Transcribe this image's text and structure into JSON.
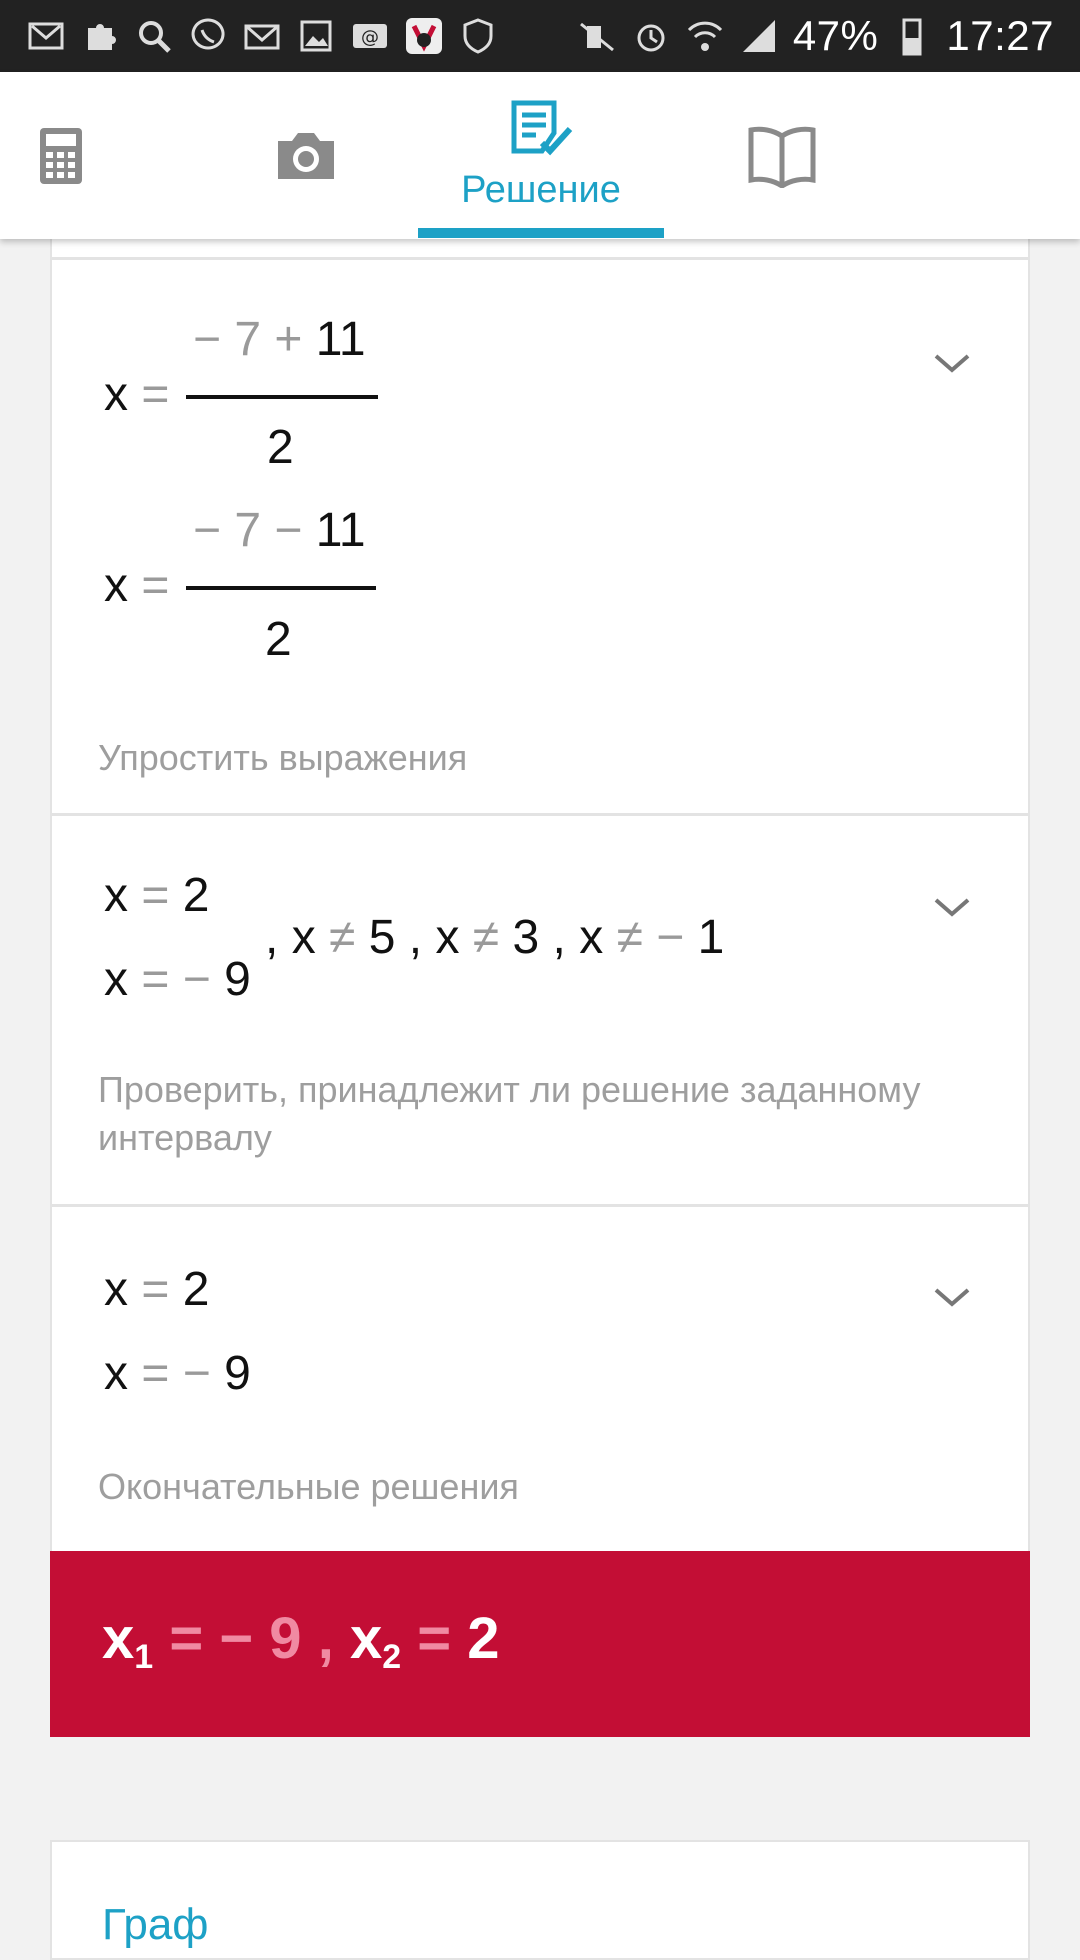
{
  "status_bar": {
    "battery": "47%",
    "time": "17:27",
    "left_icons": [
      "gmail-icon",
      "puzzle-icon",
      "search-icon",
      "viber-icon",
      "mail-icon",
      "gallery-icon",
      "email-at-icon",
      "game-icon",
      "shield-icon"
    ],
    "right_icons": [
      "mute-icon",
      "alarm-icon",
      "wifi-icon",
      "signal-icon",
      "battery-icon"
    ]
  },
  "tabs": [
    {
      "name": "calculator",
      "icon": "calculator-icon",
      "label": ""
    },
    {
      "name": "camera",
      "icon": "camera-icon",
      "label": ""
    },
    {
      "name": "solution",
      "icon": "solution-icon",
      "label": "Решение",
      "active": true
    },
    {
      "name": "book",
      "icon": "book-icon",
      "label": ""
    }
  ],
  "steps": [
    {
      "equations": [
        {
          "var": "x",
          "eq": "=",
          "num_a": "− 7",
          "num_op": "+",
          "num_b": "11",
          "den": "2"
        },
        {
          "var": "x",
          "eq": "=",
          "num_a": "− 7",
          "num_op": "−",
          "num_b": "11",
          "den": "2"
        }
      ],
      "description": "Упростить выражения"
    },
    {
      "roots": [
        {
          "var": "x",
          "eq": "=",
          "value": "2"
        },
        {
          "var": "x",
          "eq": "=",
          "sign": "−",
          "value": "9"
        }
      ],
      "conditions": [
        {
          "sep": ",",
          "var": "x",
          "rel": "≠",
          "value": "5"
        },
        {
          "sep": ",",
          "var": "x",
          "rel": "≠",
          "value": "3"
        },
        {
          "sep": ",",
          "var": "x",
          "rel": "≠",
          "sign": "−",
          "value": "1"
        }
      ],
      "description": "Проверить, принадлежит ли решение заданному интервалу"
    },
    {
      "roots": [
        {
          "var": "x",
          "eq": "=",
          "value": "2"
        },
        {
          "var": "x",
          "eq": "=",
          "sign": "−",
          "value": "9"
        }
      ],
      "description": "Окончательные решения"
    }
  ],
  "answer": {
    "var": "x",
    "sub1": "1",
    "eq": "=",
    "val1": "− 9",
    "sep": ",",
    "sub2": "2",
    "val2": "2"
  },
  "graph_card": {
    "title": "Граф"
  },
  "colors": {
    "accent": "#1da1c6",
    "answer_bg": "#c30e35"
  }
}
